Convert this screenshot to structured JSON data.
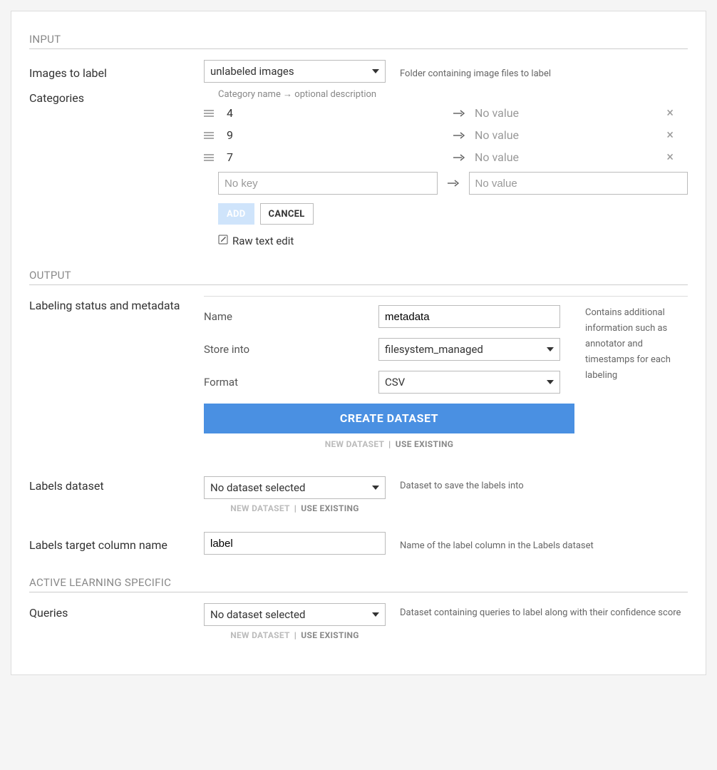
{
  "sections": {
    "input": "INPUT",
    "output": "OUTPUT",
    "active_learning": "ACTIVE LEARNING SPECIFIC"
  },
  "input": {
    "images_to_label": {
      "label": "Images to label",
      "value": "unlabeled images",
      "helper": "Folder containing image files to label"
    },
    "categories": {
      "label": "Categories",
      "hint": "Category name → optional description",
      "rows": [
        {
          "key": "4",
          "value_placeholder": "No value"
        },
        {
          "key": "9",
          "value_placeholder": "No value"
        },
        {
          "key": "7",
          "value_placeholder": "No value"
        }
      ],
      "new_key_placeholder": "No key",
      "new_value_placeholder": "No value",
      "add_label": "ADD",
      "cancel_label": "CANCEL",
      "raw_edit_label": "Raw text edit"
    }
  },
  "output": {
    "metadata": {
      "label": "Labeling status and metadata",
      "name_label": "Name",
      "name_value": "metadata",
      "store_label": "Store into",
      "store_value": "filesystem_managed",
      "format_label": "Format",
      "format_value": "CSV",
      "helper": "Contains additional information such as annotator and timestamps for each labeling",
      "create_button": "CREATE DATASET",
      "toggle_new": "NEW DATASET",
      "toggle_existing": "USE EXISTING"
    },
    "labels_dataset": {
      "label": "Labels dataset",
      "value": "No dataset selected",
      "helper": "Dataset to save the labels into",
      "toggle_new": "NEW DATASET",
      "toggle_existing": "USE EXISTING"
    },
    "labels_target": {
      "label": "Labels target column name",
      "value": "label",
      "helper": "Name of the label column in the Labels dataset"
    }
  },
  "active_learning": {
    "queries": {
      "label": "Queries",
      "value": "No dataset selected",
      "helper": "Dataset containing queries to label along with their confidence score",
      "toggle_new": "NEW DATASET",
      "toggle_existing": "USE EXISTING"
    }
  }
}
